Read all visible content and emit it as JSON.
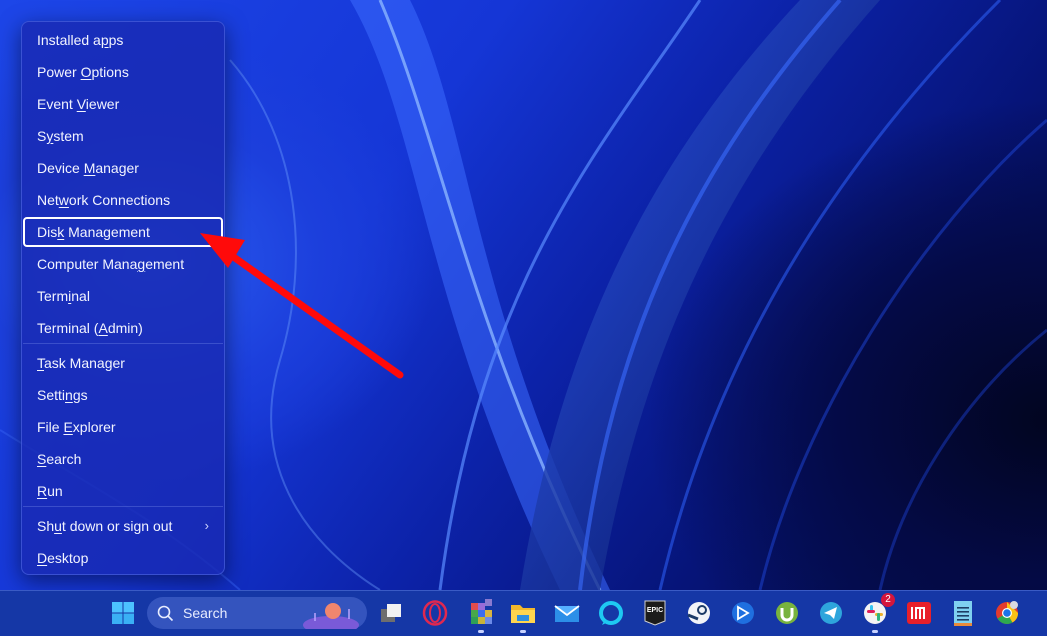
{
  "context_menu": {
    "items": [
      {
        "pre": "Installed a",
        "u": "p",
        "post": "ps"
      },
      {
        "pre": "Power ",
        "u": "O",
        "post": "ptions"
      },
      {
        "pre": "Event ",
        "u": "V",
        "post": "iewer"
      },
      {
        "pre": "S",
        "u": "y",
        "post": "stem"
      },
      {
        "pre": "Device ",
        "u": "M",
        "post": "anager"
      },
      {
        "pre": "Net",
        "u": "w",
        "post": "ork Connections"
      },
      {
        "pre": "Dis",
        "u": "k",
        "post": " Management",
        "selected": true
      },
      {
        "pre": "Computer Mana",
        "u": "g",
        "post": "ement"
      },
      {
        "pre": "Term",
        "u": "i",
        "post": "nal"
      },
      {
        "pre": "Terminal (",
        "u": "A",
        "post": "dmin)"
      },
      {
        "pre": "",
        "u": "T",
        "post": "ask Manager"
      },
      {
        "pre": "Setti",
        "u": "n",
        "post": "gs"
      },
      {
        "pre": "File ",
        "u": "E",
        "post": "xplorer"
      },
      {
        "pre": "",
        "u": "S",
        "post": "earch"
      },
      {
        "pre": "",
        "u": "R",
        "post": "un"
      },
      {
        "pre": "Sh",
        "u": "u",
        "post": "t down or sign out",
        "submenu": true
      },
      {
        "pre": "",
        "u": "D",
        "post": "esktop"
      }
    ],
    "submenu_glyph": "›"
  },
  "annotation": {
    "type": "red-arrow",
    "points_to": "Disk Management",
    "color": "#ff0a0a"
  },
  "taskbar": {
    "search_placeholder": "Search",
    "slack_badge": "2",
    "apps": [
      "start-icon",
      "search-box",
      "task-view-icon",
      "opera-icon",
      "pixelated-app-icon",
      "file-explorer-icon",
      "mail-icon",
      "amazon-alexa-icon",
      "epic-games-icon",
      "steam-icon",
      "bitdefender-icon",
      "utorrent-icon",
      "telegram-icon",
      "slack-icon",
      "app-m-icon",
      "notepad-icon",
      "chrome-icon"
    ],
    "epic_label": "EPIC"
  },
  "colors": {
    "menu_bg": "#182ab2",
    "taskbar_bg": "#1537a6",
    "selection_border": "#ffffff",
    "arrow": "#ff0a0a"
  }
}
